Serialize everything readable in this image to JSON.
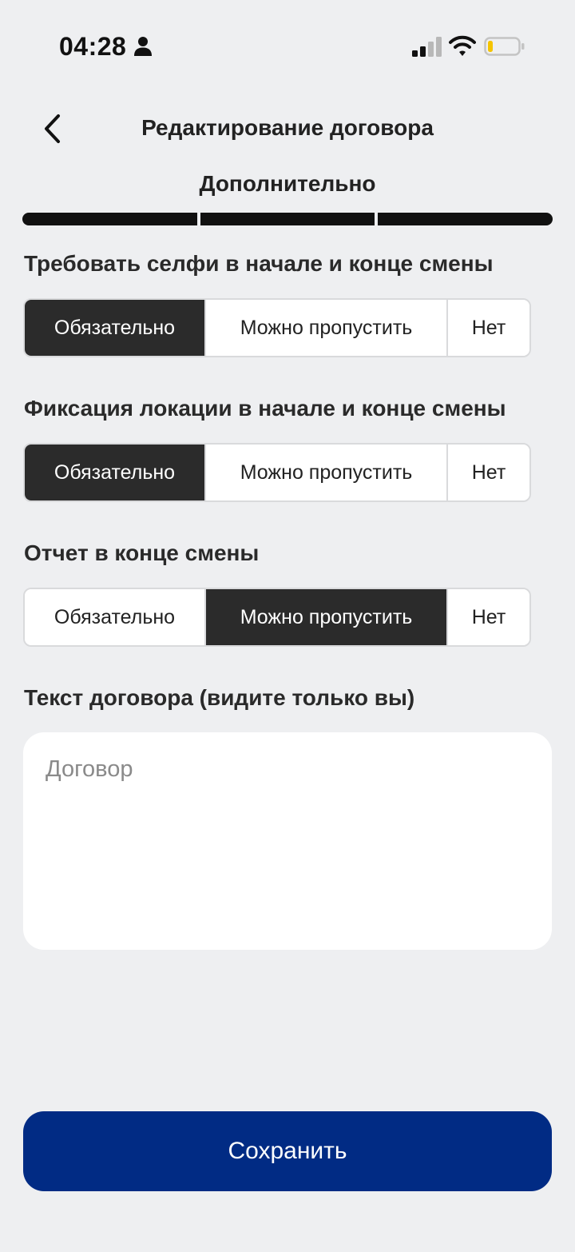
{
  "status_bar": {
    "time": "04:28",
    "icons": [
      "person-icon",
      "signal-icon",
      "wifi-icon",
      "battery-icon"
    ]
  },
  "header": {
    "title": "Редактирование договора",
    "step_title": "Дополнительно",
    "progress_steps_total": 3,
    "progress_steps_completed": 3
  },
  "sections": [
    {
      "label": "Требовать селфи в начале и конце смены",
      "options": [
        "Обязательно",
        "Можно пропустить",
        "Нет"
      ],
      "selected": "Обязательно"
    },
    {
      "label": "Фиксация локации в начале и конце смены",
      "options": [
        "Обязательно",
        "Можно пропустить",
        "Нет"
      ],
      "selected": "Обязательно"
    },
    {
      "label": "Отчет в конце смены",
      "options": [
        "Обязательно",
        "Можно пропустить",
        "Нет"
      ],
      "selected": "Можно пропустить"
    }
  ],
  "contract_text": {
    "label": "Текст договора (видите только вы)",
    "placeholder": "Договор",
    "value": ""
  },
  "save_button": {
    "label": "Сохранить"
  },
  "colors": {
    "background": "#eeeff1",
    "selected_segment": "#2b2b2b",
    "primary_button": "#012b84",
    "battery_level": "#f5c400"
  }
}
